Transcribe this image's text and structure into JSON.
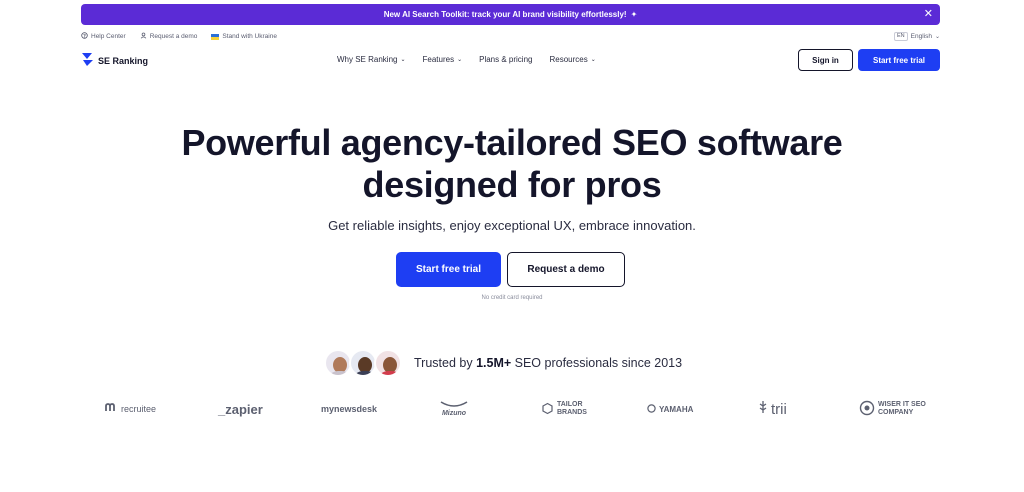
{
  "banner": {
    "text": "New AI Search Toolkit: track your AI brand visibility effortlessly!",
    "sparkle": "✦",
    "close": "✕"
  },
  "utility": {
    "help": "Help Center",
    "demo": "Request a demo",
    "ukraine": "Stand with Ukraine",
    "lang_badge": "EN",
    "lang": "English"
  },
  "nav": {
    "logo": "SE Ranking",
    "items": [
      "Why SE Ranking",
      "Features",
      "Plans & pricing",
      "Resources"
    ],
    "sign_in": "Sign in",
    "start_trial": "Start free trial"
  },
  "hero": {
    "title_line1": "Powerful agency-tailored SEO software",
    "title_line2": "designed for pros",
    "subtitle": "Get reliable insights, enjoy exceptional UX, embrace innovation.",
    "cta_primary": "Start free trial",
    "cta_secondary": "Request a demo",
    "note": "No credit card required"
  },
  "trust": {
    "prefix": "Trusted by ",
    "highlight": "1.5M+",
    "suffix": " SEO professionals since 2013"
  },
  "brands": [
    "recruitee",
    "_zapier",
    "mynewsdesk",
    "Mizuno",
    "TAILOR BRANDS",
    "YAMAHA",
    "trii",
    "WISER IT SEO COMPANY"
  ],
  "colors": {
    "banner": "#5b2bd6",
    "primary": "#1e3ef3",
    "text": "#14152a"
  }
}
